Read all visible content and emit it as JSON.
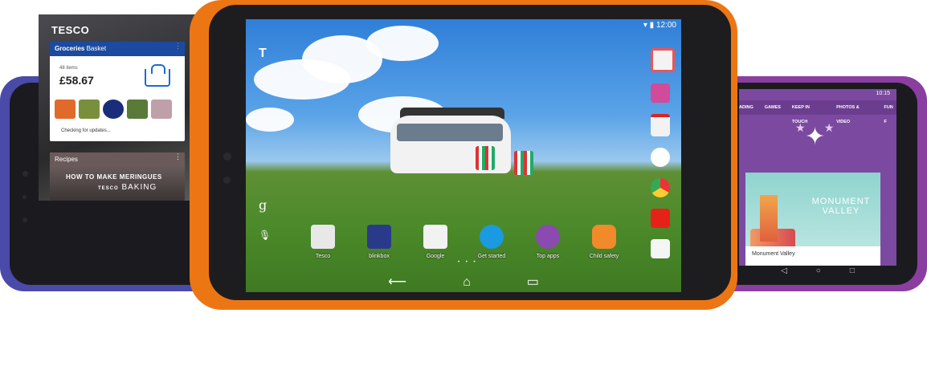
{
  "left_tablet": {
    "logo": "TESCO",
    "groceries_header": "Groceries",
    "groceries_header_sub": "Basket",
    "items_count": "48 items",
    "price": "£58.67",
    "checking": "Checking for updates...",
    "recipes_header": "Recipes",
    "recipe_title": "HOW TO MAKE MERINGUES",
    "recipe_brand": "TESCO",
    "recipe_sub": "BAKING",
    "thumb_colors": [
      "#e06a2a",
      "#7a8f3c",
      "#1a2d7a",
      "#5a7a3a",
      "#c0a0a8"
    ]
  },
  "center_tablet": {
    "time": "12:00",
    "apps": [
      {
        "label": "Tesco",
        "color": "#e8e8e8"
      },
      {
        "label": "blinkbox",
        "color": "#2a3a8a"
      },
      {
        "label": "Google",
        "color": "#f2f2f2"
      },
      {
        "label": "Get started",
        "color": "#1a9ae0"
      },
      {
        "label": "Top apps",
        "color": "#8a4ab0"
      },
      {
        "label": "Child safety",
        "color": "#f08a2a"
      }
    ],
    "dock_colors": [
      "#f3f3f3",
      "#d24a9a",
      "#f2f2f2",
      "#ffffff",
      "#ffffff",
      "#e62117",
      "#f5f5f5"
    ],
    "side_top_glyph": "T",
    "side_mid_glyph": "g",
    "side_bottom_glyph": "🎙",
    "nav_back": "⟵",
    "nav_home": "⌂",
    "nav_recent": "▭",
    "page_dots": "• • •"
  },
  "right_tablet": {
    "time": "10:15",
    "tabs": [
      "ADING",
      "GAMES",
      "KEEP IN TOUCH",
      "PHOTOS & VIDEO",
      "FUN F"
    ],
    "game_title": "MONUMENT VALLEY",
    "game_name": "Monument Valley",
    "nav_back": "◁",
    "nav_home": "○",
    "nav_recent": "□"
  }
}
